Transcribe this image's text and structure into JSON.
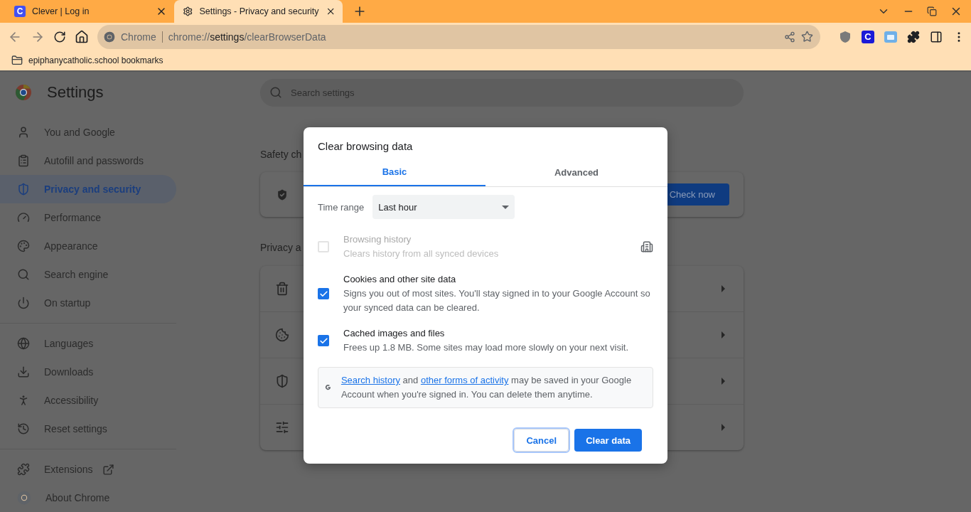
{
  "browser": {
    "tabs": [
      {
        "title": "Clever | Log in",
        "badge": "C",
        "selected": false
      },
      {
        "title": "Settings - Privacy and security",
        "selected": true
      }
    ],
    "omnibox": {
      "chip": "Chrome",
      "url": "chrome://**settings**/clearBrowserData"
    },
    "extension_badge": "C",
    "bookmarks": [
      {
        "label": "epiphanycatholic.school bookmarks"
      }
    ]
  },
  "settings": {
    "title": "Settings",
    "search_placeholder": "Search settings",
    "nav_groups": [
      [
        {
          "label": "You and Google",
          "selected": false
        },
        {
          "label": "Autofill and passwords",
          "selected": false
        },
        {
          "label": "Privacy and security",
          "selected": true
        },
        {
          "label": "Performance",
          "selected": false
        },
        {
          "label": "Appearance",
          "selected": false
        },
        {
          "label": "Search engine",
          "selected": false
        },
        {
          "label": "On startup",
          "selected": false
        }
      ],
      [
        {
          "label": "Languages",
          "selected": false
        },
        {
          "label": "Downloads",
          "selected": false
        },
        {
          "label": "Accessibility",
          "selected": false
        },
        {
          "label": "Reset settings",
          "selected": false
        }
      ],
      [
        {
          "label": "Extensions",
          "selected": false,
          "external": true
        },
        {
          "label": "About Chrome",
          "selected": false
        }
      ]
    ],
    "safety_check": {
      "heading": "Safety ch",
      "button": "Check now"
    },
    "privacy": {
      "heading": "Privacy a"
    }
  },
  "dialog": {
    "title": "Clear browsing data",
    "tabs": [
      {
        "label": "Basic",
        "selected": true
      },
      {
        "label": "Advanced",
        "selected": false
      }
    ],
    "time_range": {
      "label": "Time range",
      "value": "Last hour"
    },
    "options": [
      {
        "title": "Browsing history",
        "description": "Clears history from all synced devices",
        "checked": false,
        "disabled": true,
        "managed": true
      },
      {
        "title": "Cookies and other site data",
        "description": "Signs you out of most sites. You'll stay signed in to your Google Account so your synced data can be cleared.",
        "checked": true,
        "disabled": false
      },
      {
        "title": "Cached images and files",
        "description": "Frees up 1.8 MB. Some sites may load more slowly on your next visit.",
        "checked": true,
        "disabled": false
      }
    ],
    "notice": [
      {
        "text": "Search history",
        "link": true
      },
      {
        "text": " and ",
        "link": false
      },
      {
        "text": "other forms of activity",
        "link": true
      },
      {
        "text": " may be saved in your Google Account when you're signed in. You can delete them anytime.",
        "link": false
      }
    ],
    "buttons": [
      {
        "label": "Cancel",
        "kind": "secondary",
        "focused": true
      },
      {
        "label": "Clear data",
        "kind": "primary",
        "focused": false
      }
    ]
  }
}
